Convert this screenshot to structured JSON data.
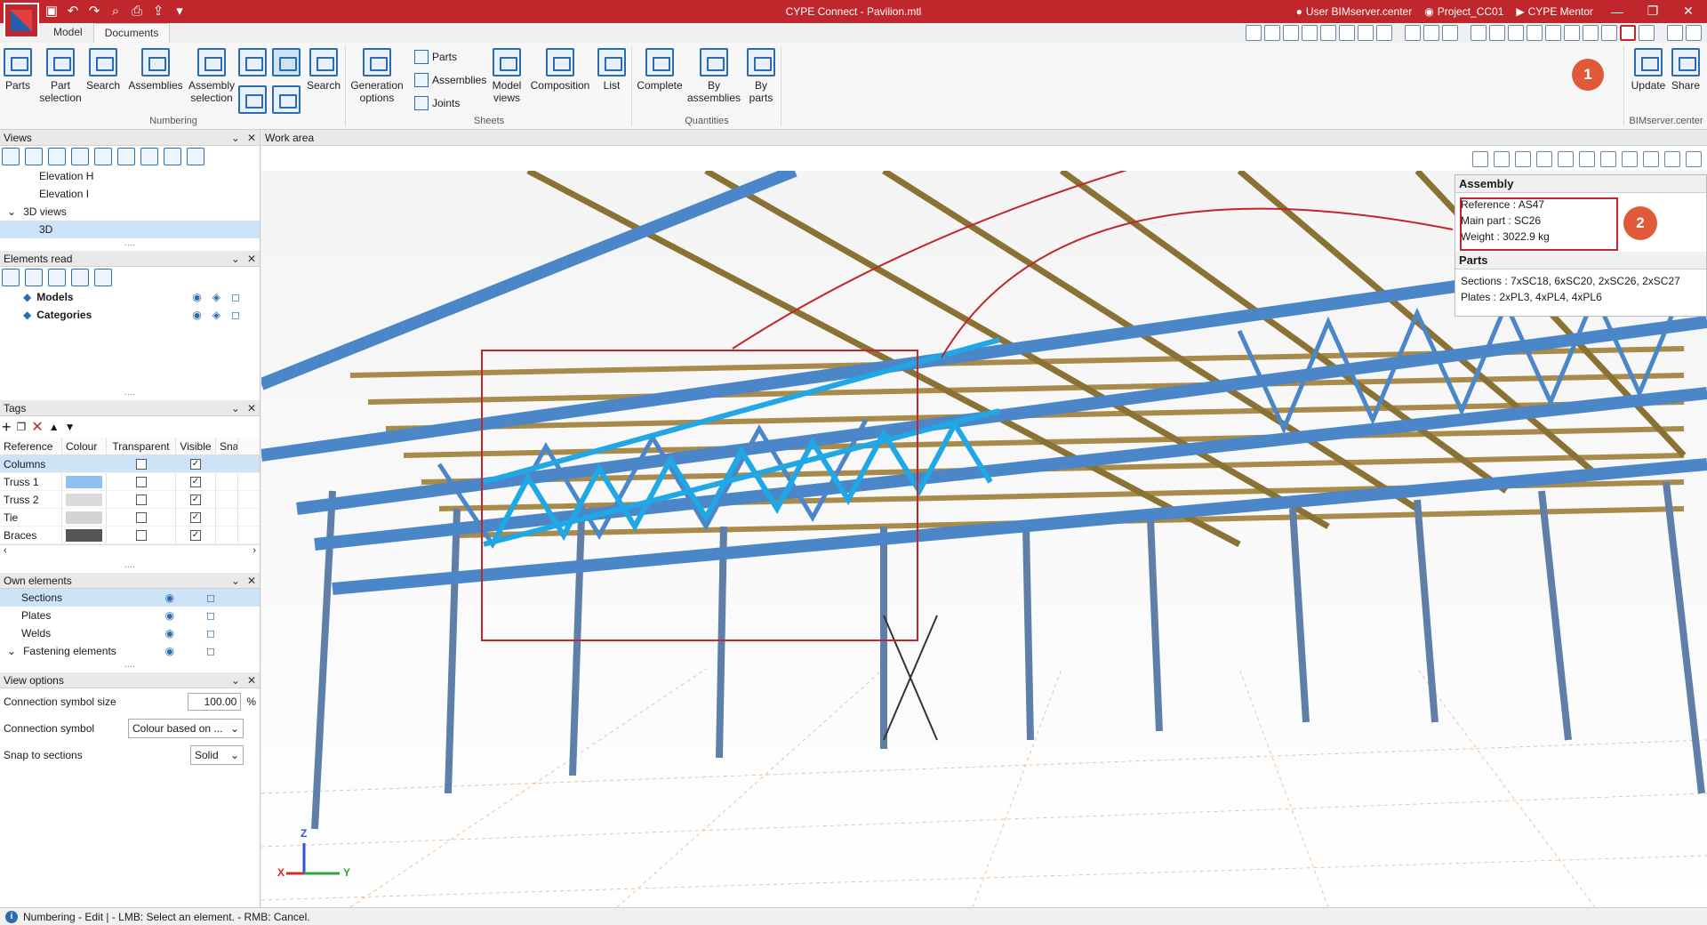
{
  "app": {
    "title": "CYPE Connect - Pavilion.mtl",
    "user": "User BIMserver.center",
    "project": "Project_CC01",
    "mentor": "CYPE Mentor"
  },
  "tabs": [
    "Model",
    "Documents"
  ],
  "ribbon": {
    "numbering": {
      "group": "Numbering",
      "parts": "Parts",
      "part_selection": "Part selection",
      "search": "Search",
      "assemblies": "Assemblies",
      "assembly_selection": "Assembly selection",
      "search2": "Search"
    },
    "sheets": {
      "group": "Sheets",
      "generation_options": "Generation options",
      "parts": "Parts",
      "assemblies": "Assemblies",
      "joints": "Joints",
      "model_views": "Model views",
      "composition": "Composition",
      "list": "List"
    },
    "quantities": {
      "group": "Quantities",
      "complete": "Complete",
      "by_assemblies": "By assemblies",
      "by_parts": "By parts"
    },
    "bim": {
      "group": "BIMserver.center",
      "update": "Update",
      "share": "Share"
    }
  },
  "callouts": {
    "one": "1",
    "two": "2"
  },
  "views_panel": {
    "title": "Views",
    "items": [
      {
        "label": "Elevation H",
        "type": "item"
      },
      {
        "label": "Elevation I",
        "type": "item"
      },
      {
        "label": "3D views",
        "type": "group"
      },
      {
        "label": "3D",
        "type": "item",
        "selected": true
      }
    ]
  },
  "elements_panel": {
    "title": "Elements read",
    "items": [
      "Models",
      "Categories"
    ]
  },
  "tags_panel": {
    "title": "Tags",
    "headers": [
      "Reference",
      "Colour",
      "Transparent",
      "Visible",
      "Snap"
    ],
    "rows": [
      {
        "ref": "Columns",
        "color": "#cde3f7",
        "transparent": false,
        "visible": true
      },
      {
        "ref": "Truss 1",
        "color": "#8fc1ef",
        "transparent": false,
        "visible": true
      },
      {
        "ref": "Truss 2",
        "color": "#dadada",
        "transparent": false,
        "visible": true
      },
      {
        "ref": "Tie",
        "color": "#d4d4d4",
        "transparent": false,
        "visible": true
      },
      {
        "ref": "Braces",
        "color": "#555555",
        "transparent": false,
        "visible": true
      }
    ]
  },
  "own_panel": {
    "title": "Own elements",
    "items": [
      "Sections",
      "Plates",
      "Welds",
      "Fastening elements"
    ]
  },
  "view_options": {
    "title": "View options",
    "symbol_size_label": "Connection symbol size",
    "symbol_size_value": "100.00",
    "symbol_size_unit": "%",
    "symbol_label": "Connection symbol",
    "symbol_value": "Colour based on ...",
    "snap_label": "Snap to sections",
    "snap_value": "Solid"
  },
  "workarea": {
    "title": "Work area"
  },
  "info": {
    "assembly_title": "Assembly",
    "reference": "Reference : AS47",
    "main_part": "Main part : SC26",
    "weight": "Weight    : 3022.9 kg",
    "parts_title": "Parts",
    "sections": "Sections : 7xSC18, 6xSC20, 2xSC26, 2xSC27",
    "plates": "Plates    : 2xPL3, 4xPL4, 4xPL6"
  },
  "axes": {
    "z": "Z",
    "x": "X",
    "y": "Y"
  },
  "status": "Numbering - Edit  |  - LMB: Select an element. - RMB: Cancel."
}
